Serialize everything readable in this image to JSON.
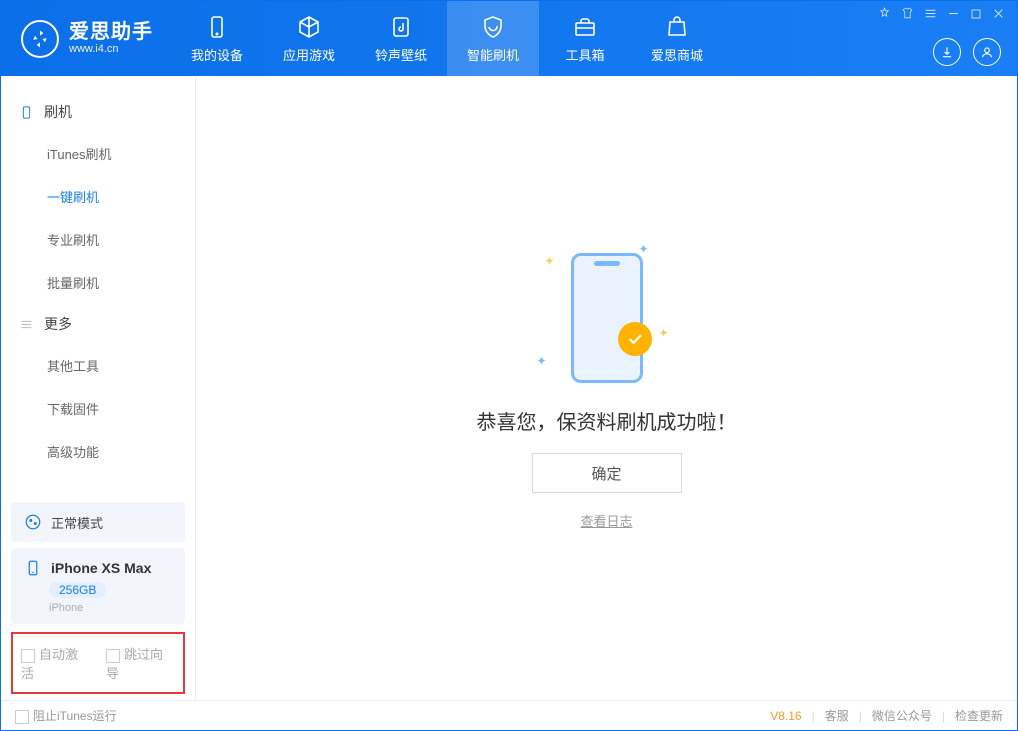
{
  "header": {
    "app_title": "爱思助手",
    "app_sub": "www.i4.cn",
    "nav": [
      {
        "label": "我的设备"
      },
      {
        "label": "应用游戏"
      },
      {
        "label": "铃声壁纸"
      },
      {
        "label": "智能刷机"
      },
      {
        "label": "工具箱"
      },
      {
        "label": "爱思商城"
      }
    ]
  },
  "sidebar": {
    "group1_title": "刷机",
    "group1_items": [
      {
        "label": "iTunes刷机"
      },
      {
        "label": "一键刷机"
      },
      {
        "label": "专业刷机"
      },
      {
        "label": "批量刷机"
      }
    ],
    "group2_title": "更多",
    "group2_items": [
      {
        "label": "其他工具"
      },
      {
        "label": "下载固件"
      },
      {
        "label": "高级功能"
      }
    ],
    "mode_label": "正常模式",
    "device": {
      "name": "iPhone XS Max",
      "storage": "256GB",
      "type": "iPhone"
    },
    "opt_auto_activate": "自动激活",
    "opt_skip_guide": "跳过向导"
  },
  "main": {
    "success": "恭喜您，保资料刷机成功啦！",
    "ok": "确定",
    "view_log": "查看日志"
  },
  "footer": {
    "block_itunes": "阻止iTunes运行",
    "version": "V8.16",
    "service": "客服",
    "wechat": "微信公众号",
    "update": "检查更新"
  }
}
